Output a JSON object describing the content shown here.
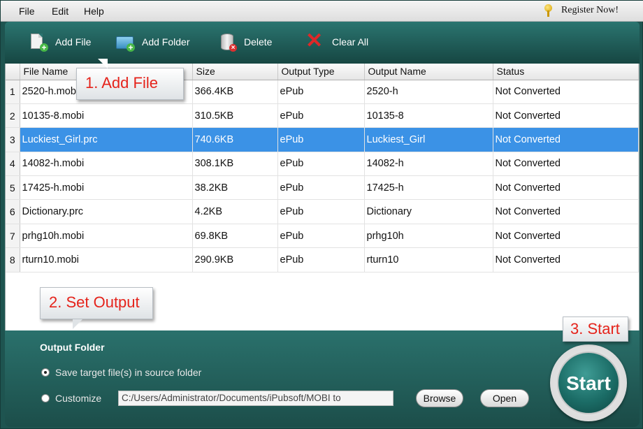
{
  "menu": {
    "items": [
      "File",
      "Edit",
      "Help"
    ],
    "register_label": "Register Now!"
  },
  "toolbar": {
    "add_file": "Add File",
    "add_folder": "Add Folder",
    "delete": "Delete",
    "clear_all": "Clear All"
  },
  "table": {
    "columns": [
      "File Name",
      "Size",
      "Output Type",
      "Output Name",
      "Status"
    ],
    "rows": [
      {
        "n": "1",
        "file": "2520-h.mobi",
        "size": "366.4KB",
        "type": "ePub",
        "out": "2520-h",
        "status": "Not Converted"
      },
      {
        "n": "2",
        "file": "10135-8.mobi",
        "size": "310.5KB",
        "type": "ePub",
        "out": "10135-8",
        "status": "Not Converted"
      },
      {
        "n": "3",
        "file": "Luckiest_Girl.prc",
        "size": "740.6KB",
        "type": "ePub",
        "out": "Luckiest_Girl",
        "status": "Not Converted"
      },
      {
        "n": "4",
        "file": "14082-h.mobi",
        "size": "308.1KB",
        "type": "ePub",
        "out": "14082-h",
        "status": "Not Converted"
      },
      {
        "n": "5",
        "file": "17425-h.mobi",
        "size": "38.2KB",
        "type": "ePub",
        "out": "17425-h",
        "status": "Not Converted"
      },
      {
        "n": "6",
        "file": "Dictionary.prc",
        "size": "4.2KB",
        "type": "ePub",
        "out": "Dictionary",
        "status": "Not Converted"
      },
      {
        "n": "7",
        "file": "prhg10h.mobi",
        "size": "69.8KB",
        "type": "ePub",
        "out": "prhg10h",
        "status": "Not Converted"
      },
      {
        "n": "8",
        "file": "rturn10.mobi",
        "size": "290.9KB",
        "type": "ePub",
        "out": "rturn10",
        "status": "Not Converted"
      }
    ],
    "selected_row": 3
  },
  "callouts": {
    "step1": "1. Add File",
    "step2": "2. Set Output",
    "step3": "3. Start"
  },
  "output": {
    "title": "Output Folder",
    "option_source": "Save target file(s) in source folder",
    "option_custom": "Customize",
    "path": "C:/Users/Administrator/Documents/iPubsoft/MOBI to",
    "browse": "Browse",
    "open": "Open",
    "selected_option": "source"
  },
  "start": {
    "label": "Start"
  },
  "colors": {
    "accent": "#1e5450",
    "selection": "#3b92e6",
    "callout_text": "#e5231b"
  }
}
